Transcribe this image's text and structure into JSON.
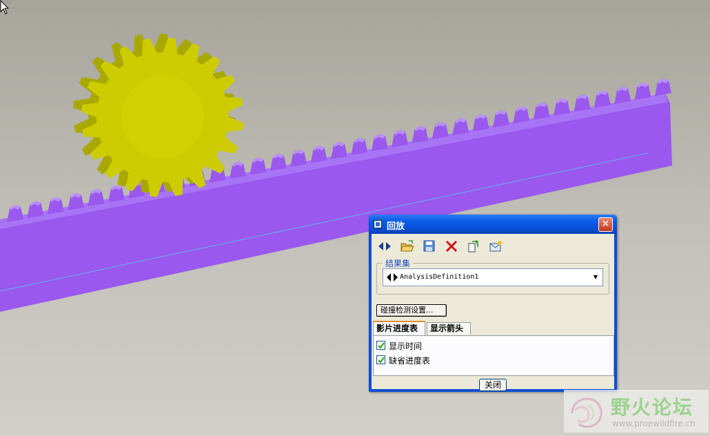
{
  "viewport": {
    "scene": "gear-and-rack-model",
    "colors": {
      "gear": "#cccc00",
      "rack": "#9a58ee",
      "rack_shadow": "#7a3dd0",
      "axis_line": "#5fb4f0",
      "background": "#bdbbb3"
    }
  },
  "dialog": {
    "title": "回放",
    "close_icon": "close-x-icon",
    "toolbar": [
      {
        "name": "nav-arrows-icon"
      },
      {
        "name": "open-folder-icon"
      },
      {
        "name": "save-icon"
      },
      {
        "name": "delete-icon"
      },
      {
        "name": "export-icon"
      },
      {
        "name": "mail-icon"
      }
    ],
    "result_set": {
      "legend": "结果集",
      "value": "AnalysisDefinition1"
    },
    "collision_button": "碰撞检测设置...",
    "tabs": [
      {
        "label": "影片进度表",
        "active": true
      },
      {
        "label": "显示箭头",
        "active": false
      }
    ],
    "options": [
      {
        "label": "显示时间",
        "checked": true
      },
      {
        "label": "缺省进度表",
        "checked": true
      }
    ],
    "close_button": "关闭",
    "colors": {
      "titlebar": "#0a5be8",
      "client": "#ece9d8",
      "legend": "#1c46c4"
    }
  },
  "watermark": {
    "title": "野火论坛",
    "url": "www.proewildfire.cn"
  }
}
